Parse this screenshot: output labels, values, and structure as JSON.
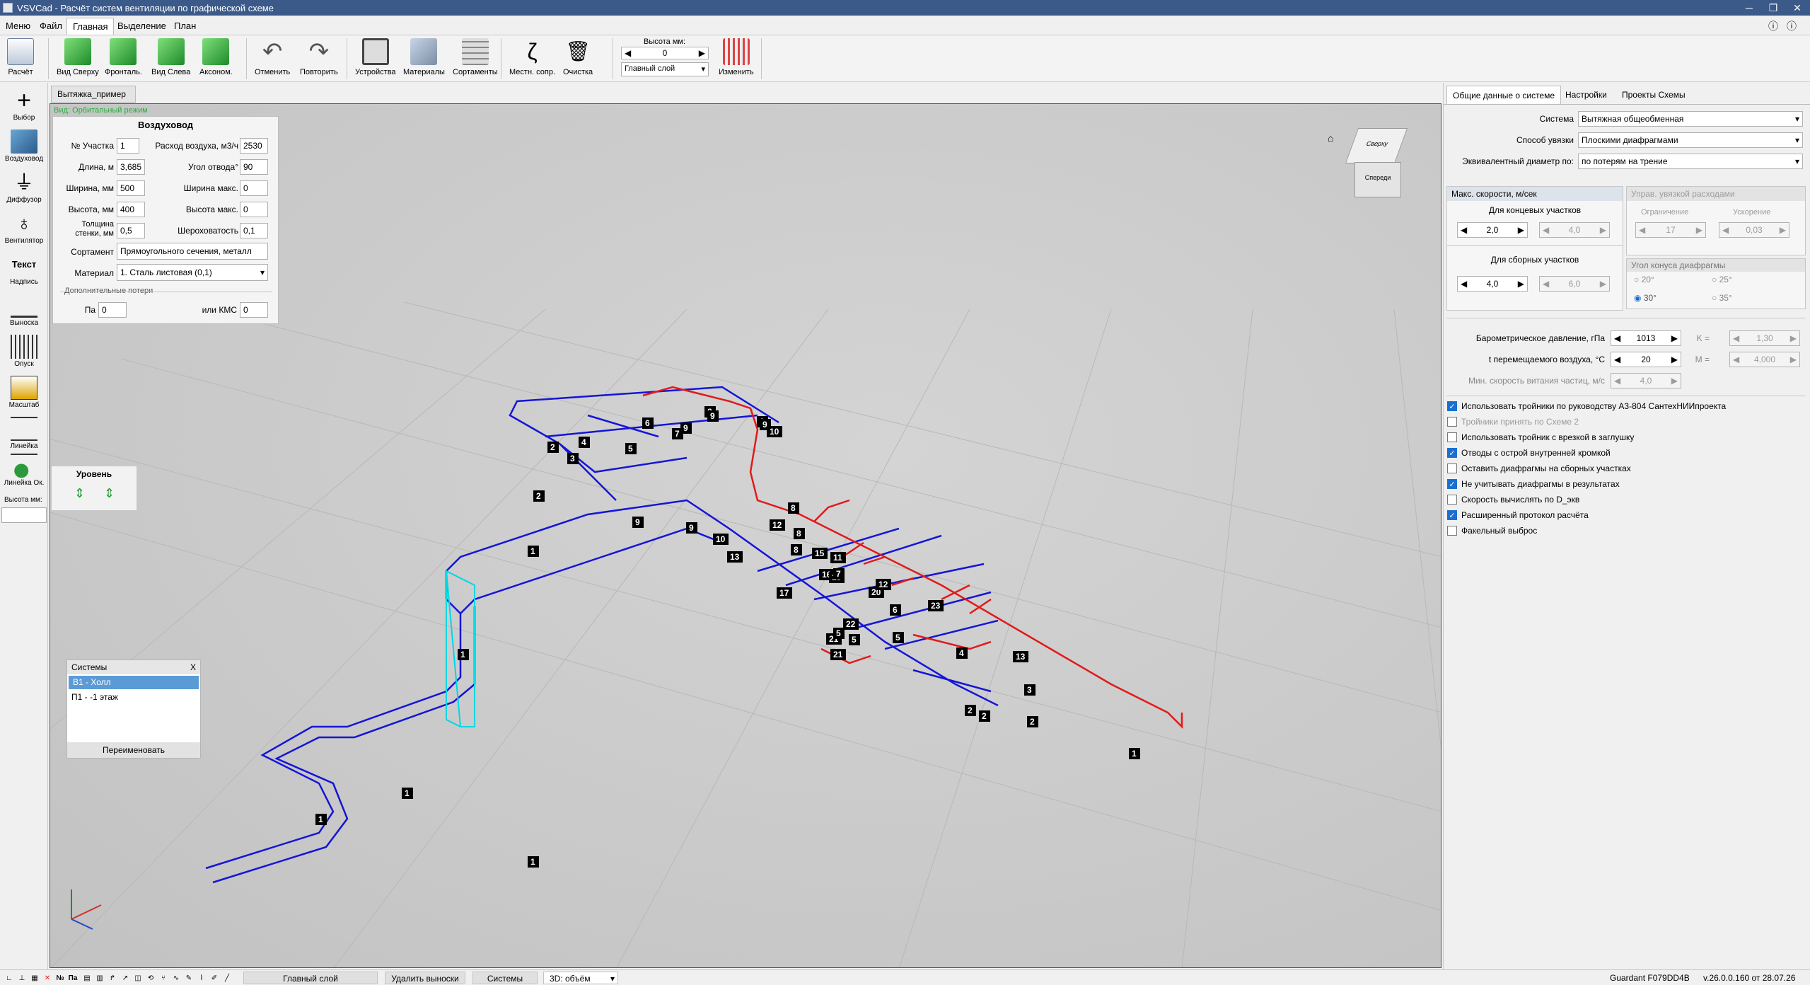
{
  "window": {
    "title": "VSVCad - Расчёт систем вентиляции по графической схеме"
  },
  "menu": [
    {
      "label": "Меню"
    },
    {
      "label": "Файл"
    },
    {
      "label": "Главная"
    },
    {
      "label": "Выделение"
    },
    {
      "label": "План"
    }
  ],
  "ribbon": {
    "calc": "Расчёт",
    "top": "Вид Сверху",
    "front": "Фронталь.",
    "left": "Вид Слева",
    "axon": "Аксоном.",
    "undo": "Отменить",
    "redo": "Повторить",
    "devices": "Устройства",
    "materials": "Материалы",
    "sortaments": "Сортаменты",
    "local": "Местн. сопр.",
    "clear": "Очистка",
    "height_label": "Высота мм:",
    "height_value": "0",
    "layer": "Главный слой",
    "change": "Изменить"
  },
  "left_tools": [
    {
      "label": "Выбор"
    },
    {
      "label": "Воздуховод"
    },
    {
      "label": "Диффузор"
    },
    {
      "label": "Вентилятор"
    },
    {
      "label": "Надпись",
      "big": "Текст"
    },
    {
      "label": "Выноска"
    },
    {
      "label": "Опуск"
    },
    {
      "label": "Масштаб"
    },
    {
      "label": "Линейка"
    },
    {
      "label": "Линейка Ок."
    },
    {
      "label": "Высота мм:"
    }
  ],
  "doc_tab": "Вытяжка_пример",
  "view_mode": "Вид: Орбитальный режим",
  "duct": {
    "header": "Воздуховод",
    "l_section": "№ Участка",
    "v_section": "1",
    "l_flow": "Расход воздуха, м3/ч",
    "v_flow": "2530",
    "l_length": "Длина, м",
    "v_length": "3,685",
    "l_angle": "Угол отвода°",
    "v_angle": "90",
    "l_width": "Ширина, мм",
    "v_width": "500",
    "l_width_max": "Ширина макс.",
    "v_width_max": "0",
    "l_height": "Высота, мм",
    "v_height": "400",
    "l_height_max": "Высота макс.",
    "v_height_max": "0",
    "l_wall": "Толщина стенки, мм",
    "v_wall": "0,5",
    "l_rough": "Шероховатость",
    "v_rough": "0,1",
    "l_sort": "Сортамент",
    "v_sort": "Прямоугольного сечения, металл",
    "l_mat": "Материал",
    "v_mat": "1. Сталь листовая (0,1)",
    "l_extra": "Дополнительные потери",
    "l_pa": "Па",
    "v_pa": "0",
    "l_kms": "или КМС",
    "v_kms": "0"
  },
  "level": {
    "title": "Уровень"
  },
  "systems": {
    "title": "Системы",
    "close": "X",
    "items": [
      {
        "label": "В1 - Холл",
        "selected": true
      },
      {
        "label": "П1 - -1 этаж",
        "selected": false
      }
    ],
    "rename": "Переименовать"
  },
  "right": {
    "tabs": [
      {
        "label": "Общие данные о системе",
        "active": true
      },
      {
        "label": "Настройки",
        "active": false
      },
      {
        "label": "Проекты Схемы",
        "active": false
      }
    ],
    "l_system": "Система",
    "v_system": "Вытяжная  общеобменная",
    "l_link": "Способ увязки",
    "v_link": "Плоскими диафрагмами",
    "l_eqd": "Эквивалентный диаметр по:",
    "v_eqd": "по потерям на трение",
    "speeds": {
      "title": "Макс. скорости, м/сек",
      "end": "Для концевых участков",
      "end_v1": "2,0",
      "end_v2": "4,0",
      "col": "Для сборных участков",
      "col_v1": "4,0",
      "col_v2": "6,0"
    },
    "flows": {
      "title": "Управ. увязкой расходами",
      "limit": "Ограничение",
      "accel": "Ускорение",
      "limit_v": "17",
      "accel_v": "0,03"
    },
    "cone": {
      "title": "Угол конуса диафрагмы",
      "a20": "20°",
      "a25": "25°",
      "a30": "30°",
      "a35": "35°"
    },
    "l_baro": "Барометрическое давление, гПа",
    "v_baro": "1013",
    "l_k": "K =",
    "v_k": "1,30",
    "l_temp": "t перемещаемого воздуха, °С",
    "v_temp": "20",
    "l_m": "M =",
    "v_m": "4,000",
    "l_minv": "Мин. скорость витания частиц, м/с",
    "v_minv": "4,0",
    "checks": [
      {
        "label": "Использовать тройники по руководству А3-804 СантехНИИпроекта",
        "checked": true,
        "disabled": false
      },
      {
        "label": "Тройники принять по Схеме 2",
        "checked": false,
        "disabled": true
      },
      {
        "label": "Использовать тройник с врезкой в заглушку",
        "checked": false,
        "disabled": false
      },
      {
        "label": "Отводы с острой внутренней кромкой",
        "checked": true,
        "disabled": false
      },
      {
        "label": "Оставить диафрагмы на сборных участках",
        "checked": false,
        "disabled": false
      },
      {
        "label": "Не учитывать диафрагмы в результатах",
        "checked": true,
        "disabled": false
      },
      {
        "label": "Скорость вычислять по D_экв",
        "checked": false,
        "disabled": false
      },
      {
        "label": "Расширенный протокол расчёта",
        "checked": true,
        "disabled": false
      },
      {
        "label": "Факельный выброс",
        "checked": false,
        "disabled": false
      }
    ]
  },
  "status": {
    "main_layer": "Главный слой",
    "del_callouts": "Удалить выноски",
    "systems": "Системы",
    "view": "3D: объём",
    "guardant": "Guardant F079DD4B",
    "version": "v.26.0.0.160 от 28.07.26"
  },
  "view_cube": {
    "top": "Сверху",
    "front": "Спереди"
  },
  "blue_labels": [
    "1",
    "1",
    "1",
    "1",
    "1",
    "2",
    "2",
    "3",
    "4",
    "5",
    "6",
    "7",
    "8",
    "8",
    "9",
    "9",
    "10",
    "12",
    "13",
    "15",
    "16",
    "17",
    "19",
    "20",
    "21",
    "21",
    "22",
    "23"
  ],
  "red_labels": [
    "9",
    "9",
    "9",
    "10",
    "8",
    "8",
    "8",
    "11",
    "7",
    "12",
    "6",
    "5",
    "5",
    "5",
    "4",
    "13",
    "3",
    "2",
    "2",
    "2",
    "1"
  ]
}
